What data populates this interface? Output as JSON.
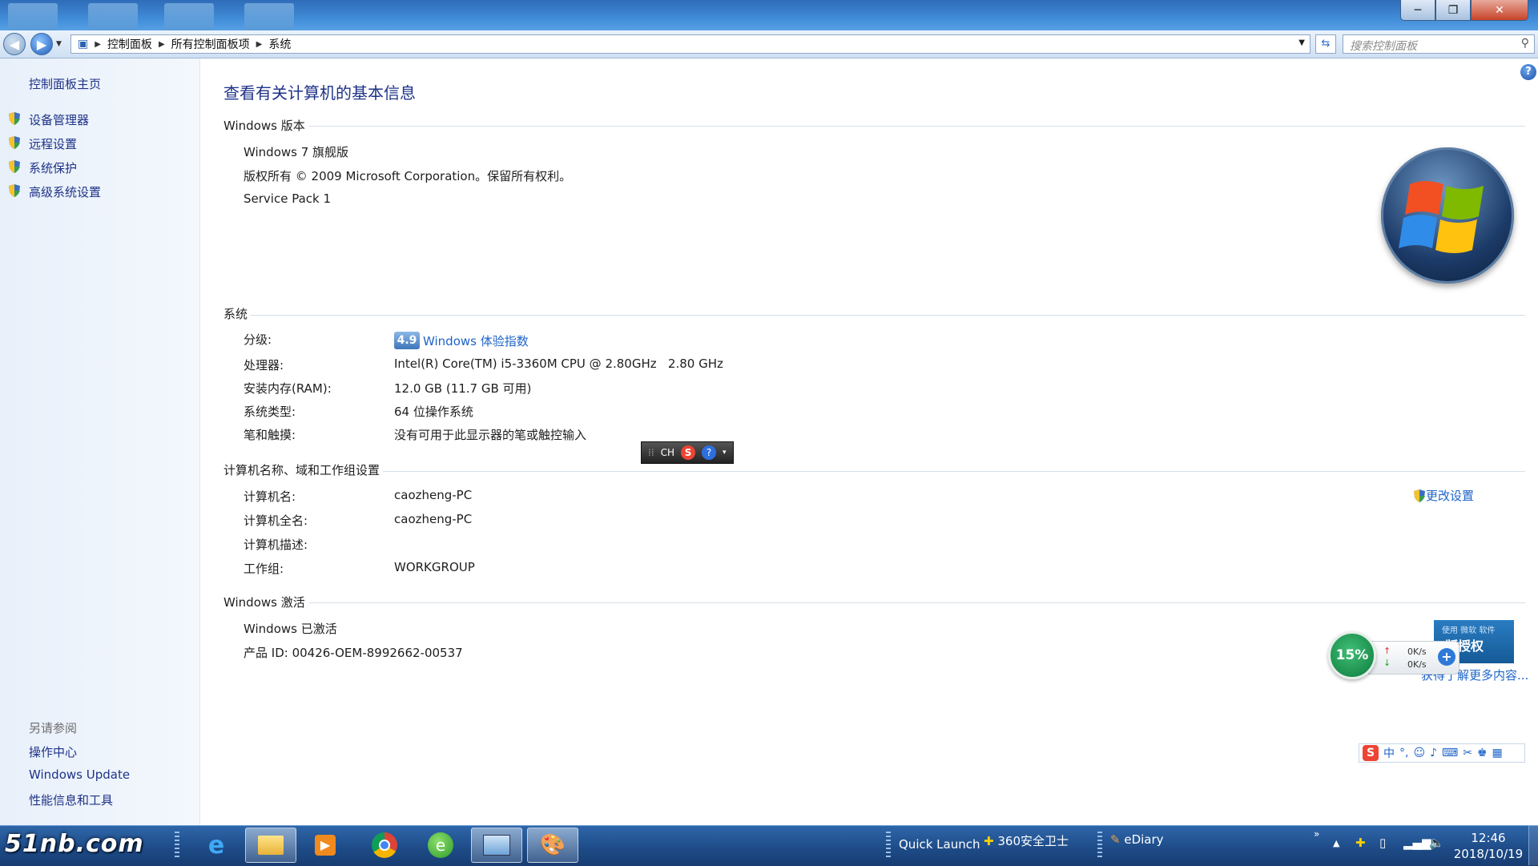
{
  "address": {
    "crumbs": [
      "控制面板",
      "所有控制面板项",
      "系统"
    ],
    "search_placeholder": "搜索控制面板"
  },
  "window_controls": {
    "minimize": "─",
    "maximize": "❐",
    "close": "✕"
  },
  "left_pane": {
    "home": "控制面板主页",
    "tasks": [
      "设备管理器",
      "远程设置",
      "系统保护",
      "高级系统设置"
    ],
    "see_also_title": "另请参阅",
    "see_also": [
      "操作中心",
      "Windows Update",
      "性能信息和工具"
    ]
  },
  "main": {
    "title": "查看有关计算机的基本信息",
    "edition": {
      "header": "Windows 版本",
      "name": "Windows 7 旗舰版",
      "copyright": "版权所有 © 2009 Microsoft Corporation。保留所有权利。",
      "service_pack": "Service Pack 1"
    },
    "system": {
      "header": "系统",
      "rating_label": "分级:",
      "rating_score": "4.9",
      "rating_link": "Windows 体验指数",
      "processor_label": "处理器:",
      "processor": "Intel(R) Core(TM) i5-3360M CPU @ 2.80GHz   2.80 GHz",
      "ram_label": "安装内存(RAM):",
      "ram": "12.0 GB (11.7 GB 可用)",
      "type_label": "系统类型:",
      "type": "64 位操作系统",
      "pen_label": "笔和触摸:",
      "pen": "没有可用于此显示器的笔或触控输入"
    },
    "computer": {
      "header": "计算机名称、域和工作组设置",
      "name_label": "计算机名:",
      "name": "caozheng-PC",
      "fullname_label": "计算机全名:",
      "fullname": "caozheng-PC",
      "desc_label": "计算机描述:",
      "desc": "",
      "workgroup_label": "工作组:",
      "workgroup": "WORKGROUP",
      "change_link": "更改设置"
    },
    "activation": {
      "header": "Windows 激活",
      "status": "Windows 已激活",
      "product_id": "产品 ID: 00426-OEM-8992662-00537"
    }
  },
  "overlays": {
    "ime_lang": "CH",
    "net_percent": "15%",
    "net_up": "0K/s",
    "net_down": "0K/s",
    "ad_text": "版授权",
    "learn_more": "获得了解更多内容..."
  },
  "taskbar": {
    "start_label": "51nb.com",
    "quick_launch": "Quick Launch",
    "item_360": "360安全卫士",
    "item_ediary": "eDiary",
    "time": "12:46",
    "date": "2018/10/19"
  },
  "colors": {
    "link": "#1e64c8",
    "title": "#1e3287",
    "taskbar": "#1d4a86"
  }
}
